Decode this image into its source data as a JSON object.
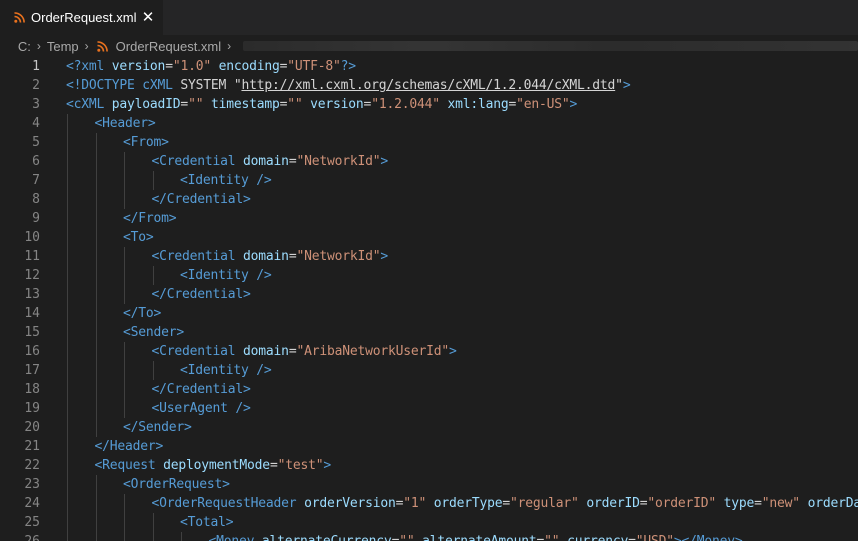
{
  "tab": {
    "title": "OrderRequest.xml",
    "close": "✕"
  },
  "breadcrumb": {
    "drive": "C:",
    "folder": "Temp",
    "file": "OrderRequest.xml"
  },
  "editor": {
    "active_line": 1,
    "lines": [
      {
        "n": "1",
        "indent": 0,
        "tokens": [
          [
            "tag",
            "<"
          ],
          [
            "tag",
            "?xml"
          ],
          [
            "plain",
            " "
          ],
          [
            "attr",
            "version"
          ],
          [
            "plain",
            "="
          ],
          [
            "str",
            "\"1.0\""
          ],
          [
            "plain",
            " "
          ],
          [
            "attr",
            "encoding"
          ],
          [
            "plain",
            "="
          ],
          [
            "str",
            "\"UTF-8\""
          ],
          [
            "tag",
            "?>"
          ]
        ]
      },
      {
        "n": "2",
        "indent": 0,
        "tokens": [
          [
            "tag",
            "<!DOCTYPE"
          ],
          [
            "plain",
            " "
          ],
          [
            "tag",
            "cXML"
          ],
          [
            "plain",
            " SYSTEM "
          ],
          [
            "plain",
            "\""
          ],
          [
            "url",
            "http://xml.cxml.org/schemas/cXML/1.2.044/cXML.dtd"
          ],
          [
            "plain",
            "\""
          ],
          [
            "tag",
            ">"
          ]
        ]
      },
      {
        "n": "3",
        "indent": 0,
        "tokens": [
          [
            "tag",
            "<cXML"
          ],
          [
            "plain",
            " "
          ],
          [
            "attr",
            "payloadID"
          ],
          [
            "plain",
            "="
          ],
          [
            "str",
            "\"\""
          ],
          [
            "plain",
            " "
          ],
          [
            "attr",
            "timestamp"
          ],
          [
            "plain",
            "="
          ],
          [
            "str",
            "\"\""
          ],
          [
            "plain",
            " "
          ],
          [
            "attr",
            "version"
          ],
          [
            "plain",
            "="
          ],
          [
            "str",
            "\"1.2.044\""
          ],
          [
            "plain",
            " "
          ],
          [
            "attr",
            "xml:lang"
          ],
          [
            "plain",
            "="
          ],
          [
            "str",
            "\"en-US\""
          ],
          [
            "tag",
            ">"
          ]
        ]
      },
      {
        "n": "4",
        "indent": 1,
        "tokens": [
          [
            "tag",
            "<Header>"
          ]
        ]
      },
      {
        "n": "5",
        "indent": 2,
        "tokens": [
          [
            "tag",
            "<From>"
          ]
        ]
      },
      {
        "n": "6",
        "indent": 3,
        "tokens": [
          [
            "tag",
            "<Credential"
          ],
          [
            "plain",
            " "
          ],
          [
            "attr",
            "domain"
          ],
          [
            "plain",
            "="
          ],
          [
            "str",
            "\"NetworkId\""
          ],
          [
            "tag",
            ">"
          ]
        ]
      },
      {
        "n": "7",
        "indent": 4,
        "tokens": [
          [
            "tag",
            "<Identity />"
          ]
        ]
      },
      {
        "n": "8",
        "indent": 3,
        "tokens": [
          [
            "tag",
            "</Credential>"
          ]
        ]
      },
      {
        "n": "9",
        "indent": 2,
        "tokens": [
          [
            "tag",
            "</From>"
          ]
        ]
      },
      {
        "n": "10",
        "indent": 2,
        "tokens": [
          [
            "tag",
            "<To>"
          ]
        ]
      },
      {
        "n": "11",
        "indent": 3,
        "tokens": [
          [
            "tag",
            "<Credential"
          ],
          [
            "plain",
            " "
          ],
          [
            "attr",
            "domain"
          ],
          [
            "plain",
            "="
          ],
          [
            "str",
            "\"NetworkId\""
          ],
          [
            "tag",
            ">"
          ]
        ]
      },
      {
        "n": "12",
        "indent": 4,
        "tokens": [
          [
            "tag",
            "<Identity />"
          ]
        ]
      },
      {
        "n": "13",
        "indent": 3,
        "tokens": [
          [
            "tag",
            "</Credential>"
          ]
        ]
      },
      {
        "n": "14",
        "indent": 2,
        "tokens": [
          [
            "tag",
            "</To>"
          ]
        ]
      },
      {
        "n": "15",
        "indent": 2,
        "tokens": [
          [
            "tag",
            "<Sender>"
          ]
        ]
      },
      {
        "n": "16",
        "indent": 3,
        "tokens": [
          [
            "tag",
            "<Credential"
          ],
          [
            "plain",
            " "
          ],
          [
            "attr",
            "domain"
          ],
          [
            "plain",
            "="
          ],
          [
            "str",
            "\"AribaNetworkUserId\""
          ],
          [
            "tag",
            ">"
          ]
        ]
      },
      {
        "n": "17",
        "indent": 4,
        "tokens": [
          [
            "tag",
            "<Identity />"
          ]
        ]
      },
      {
        "n": "18",
        "indent": 3,
        "tokens": [
          [
            "tag",
            "</Credential>"
          ]
        ]
      },
      {
        "n": "19",
        "indent": 3,
        "tokens": [
          [
            "tag",
            "<UserAgent />"
          ]
        ]
      },
      {
        "n": "20",
        "indent": 2,
        "tokens": [
          [
            "tag",
            "</Sender>"
          ]
        ]
      },
      {
        "n": "21",
        "indent": 1,
        "tokens": [
          [
            "tag",
            "</Header>"
          ]
        ]
      },
      {
        "n": "22",
        "indent": 1,
        "tokens": [
          [
            "tag",
            "<Request"
          ],
          [
            "plain",
            " "
          ],
          [
            "attr",
            "deploymentMode"
          ],
          [
            "plain",
            "="
          ],
          [
            "str",
            "\"test\""
          ],
          [
            "tag",
            ">"
          ]
        ]
      },
      {
        "n": "23",
        "indent": 2,
        "tokens": [
          [
            "tag",
            "<OrderRequest>"
          ]
        ]
      },
      {
        "n": "24",
        "indent": 3,
        "tokens": [
          [
            "tag",
            "<OrderRequestHeader"
          ],
          [
            "plain",
            " "
          ],
          [
            "attr",
            "orderVersion"
          ],
          [
            "plain",
            "="
          ],
          [
            "str",
            "\"1\""
          ],
          [
            "plain",
            " "
          ],
          [
            "attr",
            "orderType"
          ],
          [
            "plain",
            "="
          ],
          [
            "str",
            "\"regular\""
          ],
          [
            "plain",
            " "
          ],
          [
            "attr",
            "orderID"
          ],
          [
            "plain",
            "="
          ],
          [
            "str",
            "\"orderID\""
          ],
          [
            "plain",
            " "
          ],
          [
            "attr",
            "type"
          ],
          [
            "plain",
            "="
          ],
          [
            "str",
            "\"new\""
          ],
          [
            "plain",
            " "
          ],
          [
            "attr",
            "orderDate"
          ],
          [
            "plain",
            "="
          ],
          [
            "str",
            "\"\""
          ],
          [
            "tag",
            ">"
          ]
        ]
      },
      {
        "n": "25",
        "indent": 4,
        "tokens": [
          [
            "tag",
            "<Total>"
          ]
        ]
      },
      {
        "n": "26",
        "indent": 5,
        "tokens": [
          [
            "tag",
            "<Money"
          ],
          [
            "plain",
            " "
          ],
          [
            "attr",
            "alternateCurrency"
          ],
          [
            "plain",
            "="
          ],
          [
            "str",
            "\"\""
          ],
          [
            "plain",
            " "
          ],
          [
            "attr",
            "alternateAmount"
          ],
          [
            "plain",
            "="
          ],
          [
            "str",
            "\"\""
          ],
          [
            "plain",
            " "
          ],
          [
            "attr",
            "currency"
          ],
          [
            "plain",
            "="
          ],
          [
            "str",
            "\"USD\""
          ],
          [
            "tag",
            "></Money>"
          ]
        ]
      }
    ]
  },
  "colors": {
    "background": "#1e1e1e",
    "tag": "#569cd6",
    "attribute": "#9cdcfe",
    "string": "#ce9178",
    "rss_icon": "#e8711e"
  }
}
